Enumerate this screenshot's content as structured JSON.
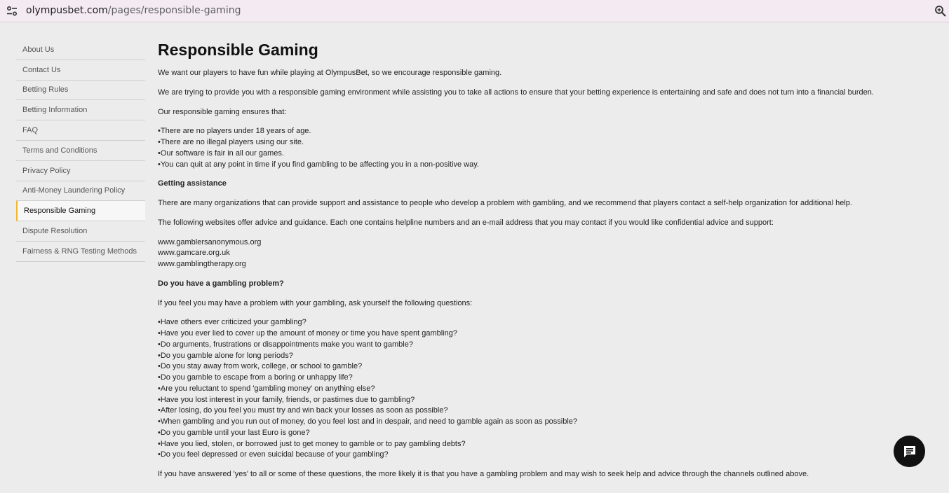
{
  "browser": {
    "url_domain": "olympusbet.com",
    "url_path": "/pages/responsible-gaming"
  },
  "sidebar": {
    "items": [
      {
        "label": "About Us"
      },
      {
        "label": "Contact Us"
      },
      {
        "label": "Betting Rules"
      },
      {
        "label": "Betting Information"
      },
      {
        "label": "FAQ"
      },
      {
        "label": "Terms and Conditions"
      },
      {
        "label": "Privacy Policy"
      },
      {
        "label": "Anti-Money Laundering Policy"
      },
      {
        "label": "Responsible Gaming",
        "active": true
      },
      {
        "label": "Dispute Resolution"
      },
      {
        "label": "Fairness & RNG Testing Methods"
      }
    ]
  },
  "main": {
    "title": "Responsible Gaming",
    "intro1": "We want our players to have fun while playing at OlympusBet, so we encourage responsible gaming.",
    "intro2": "We are trying to provide you with a responsible gaming environment while assisting you to take all actions to ensure that your betting experience is entertaining and safe and does not turn into a financial burden.",
    "ensures_heading": "Our responsible gaming ensures that:",
    "ensures": [
      "•There are no players under 18 years of age.",
      "•There are no illegal players using our site.",
      "•Our software is fair in all our games.",
      "•You can quit at any point in time if you find gambling to be affecting you in a non-positive way."
    ],
    "assistance_heading": "Getting assistance",
    "assistance_p1": "There are many organizations that can provide support and assistance to people who develop a problem with gambling, and we recommend that players contact a self-help organization for additional help.",
    "assistance_p2": "The following websites offer advice and guidance. Each one contains helpline numbers and an e-mail address that you may contact if you would like confidential advice and support:",
    "websites": [
      "www.gamblersanonymous.org",
      "www.gamcare.org.uk",
      "www.gamblingtherapy.org"
    ],
    "problem_heading": "Do you have a gambling problem?",
    "problem_intro": "If you feel you may have a problem with your gambling, ask yourself the following questions:",
    "questions": [
      "•Have others ever criticized your gambling?",
      "•Have you ever lied to cover up the amount of money or time you have spent gambling?",
      "•Do arguments, frustrations or disappointments make you want to gamble?",
      "•Do you gamble alone for long periods?",
      "•Do you stay away from work, college, or school to gamble?",
      "•Do you gamble to escape from a boring or unhappy life?",
      "•Are you reluctant to spend 'gambling money' on anything else?",
      "•Have you lost interest in your family, friends, or pastimes due to gambling?",
      "•After losing, do you feel you must try and win back your losses as soon as possible?",
      "•When gambling and you run out of money, do you feel lost and in despair, and need to gamble again as soon as possible?",
      "•Do you gamble until your last Euro is gone?",
      "•Have you lied, stolen, or borrowed just to get money to gamble or to pay gambling debts?",
      "•Do you feel depressed or even suicidal because of your gambling?"
    ],
    "closing": "If you have answered 'yes' to all or some of these questions, the more likely it is that you have a gambling problem and may wish to seek help and advice through the channels outlined above."
  },
  "icons": {
    "site_info": "tune-icon",
    "zoom": "zoom-icon",
    "chat": "chat-icon"
  }
}
